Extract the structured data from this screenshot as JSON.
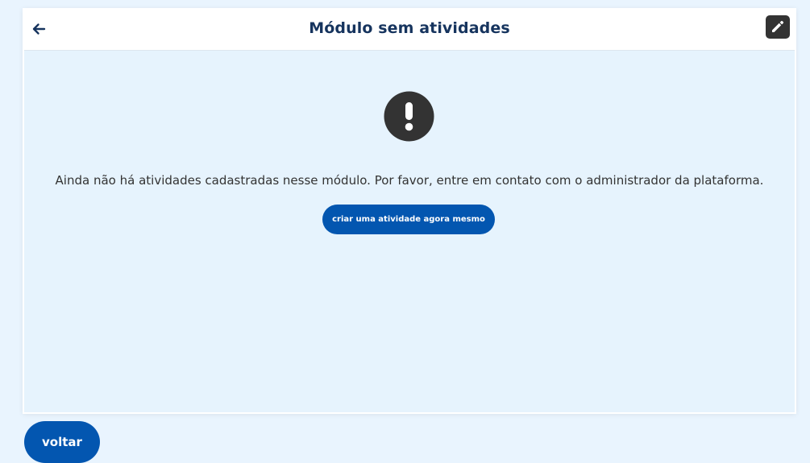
{
  "header": {
    "title": "Módulo sem atividades",
    "back_icon": "arrow-left-icon",
    "edit_icon": "pencil-icon"
  },
  "empty_state": {
    "icon": "exclamation-circle-icon",
    "message": "Ainda não há atividades cadastradas nesse módulo. Por favor, entre em contato com o administrador da plataforma.",
    "action_label": "criar uma atividade agora mesmo"
  },
  "footer": {
    "back_label": "voltar"
  },
  "colors": {
    "page_background": "#e9f4fe",
    "card_background": "#e6f3fd",
    "title": "#16345e",
    "primary_button": "#0356b0",
    "dark_icon": "#333333"
  }
}
